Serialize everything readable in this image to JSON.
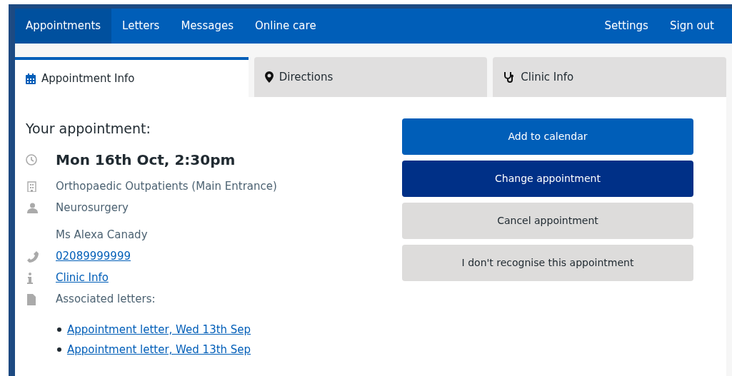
{
  "nav": {
    "items": [
      {
        "label": "Appointments",
        "selected": true
      },
      {
        "label": "Letters",
        "selected": false
      },
      {
        "label": "Messages",
        "selected": false
      },
      {
        "label": "Online care",
        "selected": false
      }
    ],
    "right_items": [
      "Settings",
      "Sign out"
    ]
  },
  "tabs": [
    {
      "label": "Appointment Info",
      "kind": "calendar",
      "selected": true
    },
    {
      "label": "Directions",
      "kind": "pin",
      "selected": false
    },
    {
      "label": "Clinic Info",
      "kind": "stethoscope",
      "selected": false
    }
  ],
  "appointment": {
    "heading": "Your appointment:",
    "datetime": "Mon 16th Oct, 2:30pm",
    "details": [
      {
        "kind": "building",
        "text": "Orthopaedic Outpatients (Main Entrance)",
        "link": false
      },
      {
        "kind": "person",
        "text": "Neurosurgery",
        "link": false
      },
      {
        "kind": "plain",
        "text": "Ms Alexa Canady",
        "link": false
      },
      {
        "kind": "phone",
        "text": "02089999999",
        "link": true
      },
      {
        "kind": "info",
        "text": "Clinic Info",
        "link": true
      },
      {
        "kind": "file",
        "text": "Associated letters:",
        "link": false
      }
    ],
    "letters": [
      "Appointment letter, Wed 13th Sep",
      "Appointment letter, Wed 13th Sep"
    ]
  },
  "actions": [
    {
      "label": "Add to calendar",
      "kind": "primary"
    },
    {
      "label": "Change appointment",
      "kind": "dark"
    },
    {
      "label": "Cancel appointment",
      "kind": "secondary"
    },
    {
      "label": "I don't recognise this appointment",
      "kind": "secondary"
    }
  ]
}
